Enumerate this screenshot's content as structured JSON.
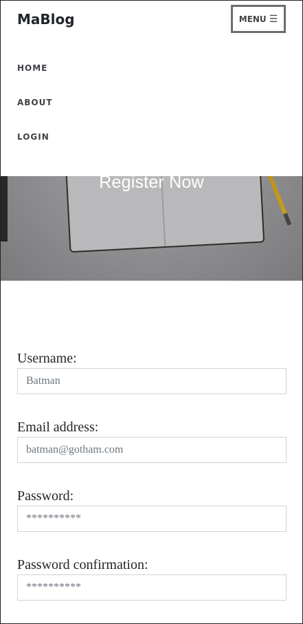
{
  "navbar": {
    "brand": "MaBlog",
    "menu_label": "MENU",
    "menu_icon": "hamburger-icon",
    "items": [
      {
        "label": "HOME"
      },
      {
        "label": "ABOUT"
      },
      {
        "label": "LOGIN"
      }
    ]
  },
  "hero": {
    "title": "Register Now"
  },
  "form": {
    "username": {
      "label": "Username:",
      "placeholder": "Batman"
    },
    "email": {
      "label": "Email address:",
      "placeholder": "batman@gotham.com"
    },
    "password": {
      "label": "Password:",
      "placeholder": "**********"
    },
    "password_confirmation": {
      "label": "Password confirmation:",
      "placeholder": "**********"
    }
  }
}
